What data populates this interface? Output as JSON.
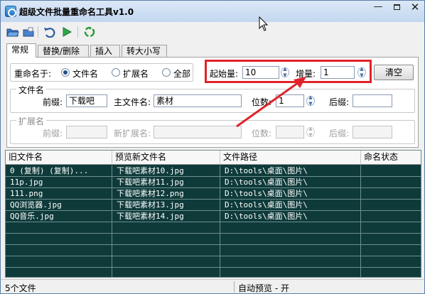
{
  "window": {
    "title": "超级文件批量重命名工具v1.0",
    "min_symbol": "—",
    "close_symbol": "✕"
  },
  "tabs": [
    "常规",
    "替换/删除",
    "插入",
    "转大小写"
  ],
  "rename": {
    "label": "重命名于:",
    "options": [
      "文件名",
      "扩展名",
      "全部"
    ],
    "selected": "文件名"
  },
  "numbering": {
    "start_label": "起始量:",
    "start_value": "10",
    "increment_label": "增量:",
    "increment_value": "1",
    "clear_label": "清空"
  },
  "filename_group": {
    "title": "文件名",
    "prefix_label": "前缀:",
    "prefix_value": "下载吧",
    "main_label": "主文件名:",
    "main_value": "素材",
    "digits_label": "位数:",
    "digits_value": "1",
    "suffix_label": "后缀:",
    "suffix_value": ""
  },
  "ext_group": {
    "title": "扩展名",
    "prefix_label": "前缀:",
    "new_ext_label": "新扩展名:",
    "digits_label": "位数:",
    "suffix_label": "后缀:"
  },
  "table": {
    "columns": [
      "旧文件名",
      "预览新文件名",
      "文件路径",
      "命名状态"
    ],
    "rows": [
      [
        "0 (复制) (复制)...",
        "下载吧素材10.jpg",
        "D:\\tools\\桌面\\图片\\",
        ""
      ],
      [
        "11p.jpg",
        "下载吧素材11.jpg",
        "D:\\tools\\桌面\\图片\\",
        ""
      ],
      [
        "111.png",
        "下载吧素材12.png",
        "D:\\tools\\桌面\\图片\\",
        ""
      ],
      [
        "QQ浏览器.jpg",
        "下载吧素材13.jpg",
        "D:\\tools\\桌面\\图片\\",
        ""
      ],
      [
        "QQ音乐.jpg",
        "下载吧素材14.jpg",
        "D:\\tools\\桌面\\图片\\",
        ""
      ]
    ]
  },
  "status": {
    "file_count": "5个文件",
    "auto_preview": "自动预览 - 开"
  },
  "colors": {
    "grid_bg": "#0e3a3a",
    "highlight": "#e0222a",
    "arrow": "#e0222a"
  }
}
